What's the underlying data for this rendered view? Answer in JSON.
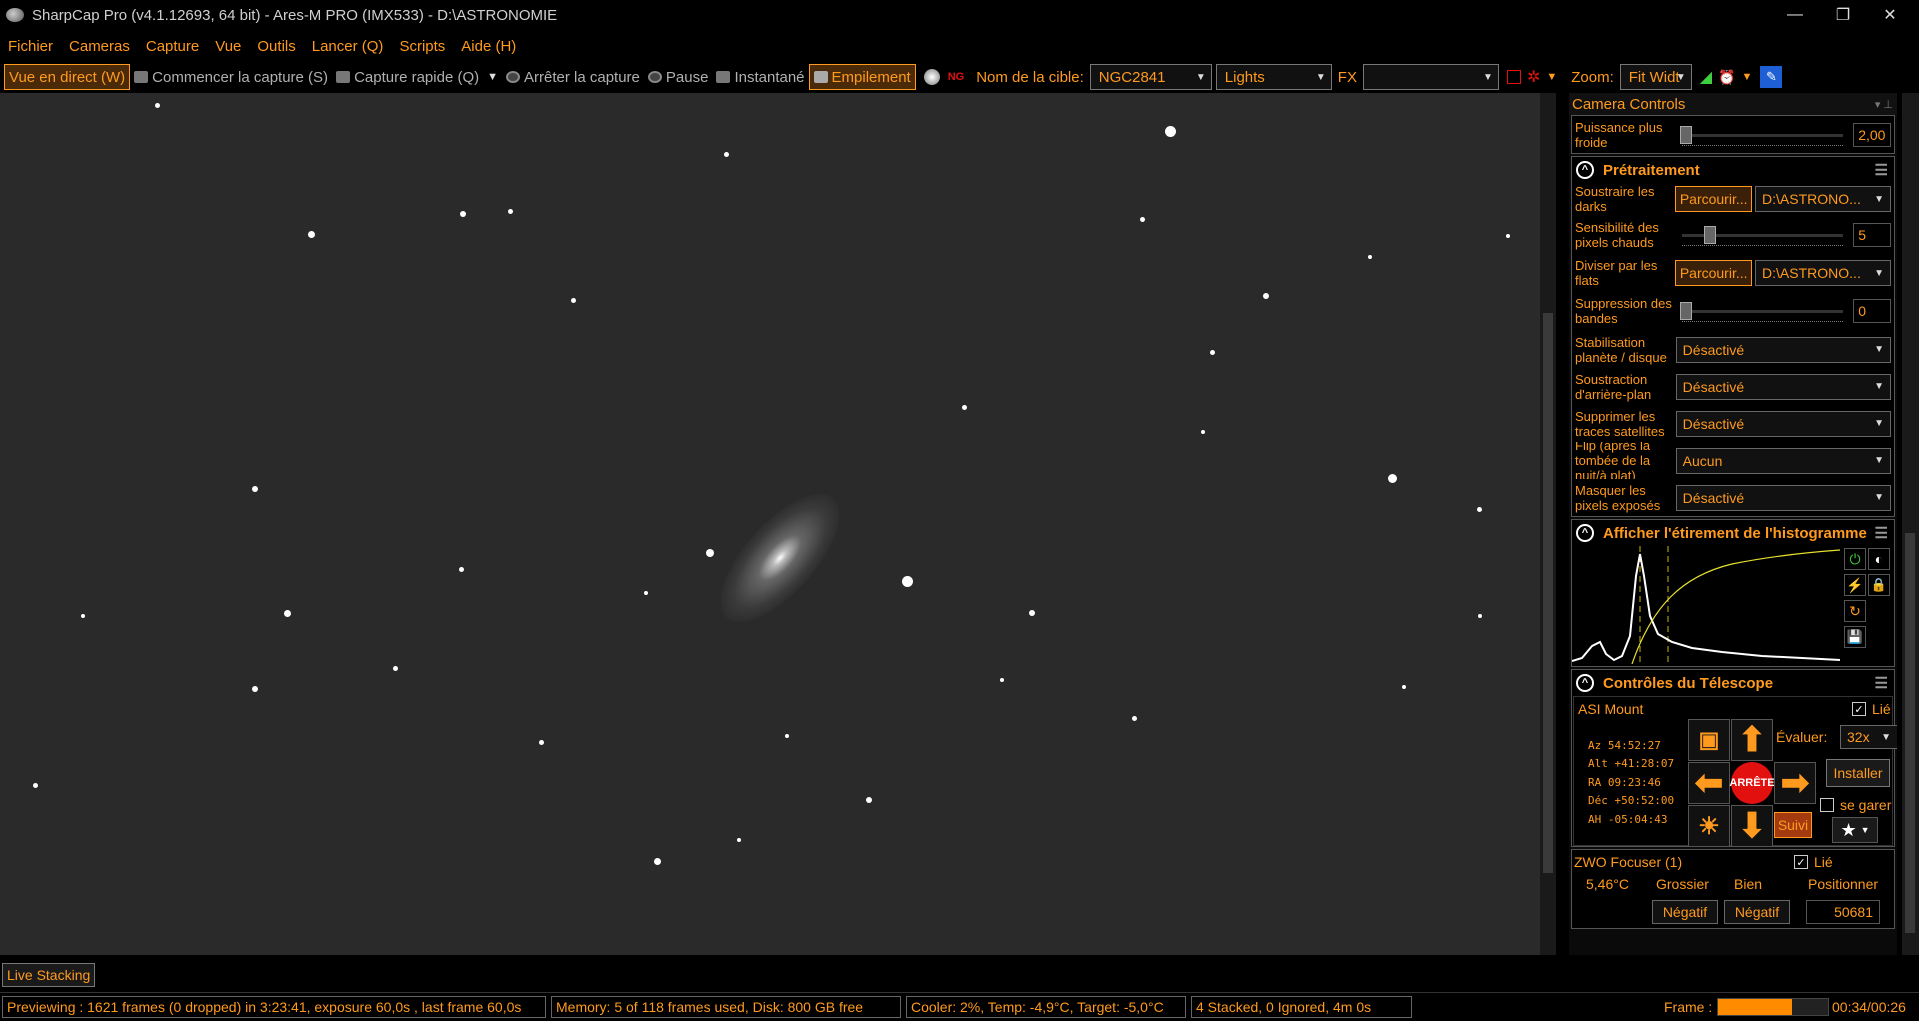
{
  "window": {
    "title": "SharpCap Pro (v4.1.12693, 64 bit) - Ares-M PRO (IMX533) - D:\\ASTRONOMIE",
    "minimize": "—",
    "maximize": "❐",
    "close": "✕"
  },
  "menu": [
    "Fichier",
    "Cameras",
    "Capture",
    "Vue",
    "Outils",
    "Lancer (Q)",
    "Scripts",
    "Aide (H)"
  ],
  "toolbar": {
    "live_view": "Vue en direct (W)",
    "start_capture": "Commencer la capture (S)",
    "quick_capture": "Capture rapide (Q)",
    "stop_capture": "Arrêter la capture",
    "pause": "Pause",
    "snapshot": "Instantané",
    "stacking": "Empilement",
    "target_label": "Nom de la cible:",
    "target_value": "NGC2841",
    "frame_type": "Lights",
    "fx_label": "FX",
    "fx_value": "",
    "zoom_label": "Zoom:",
    "zoom_value": "Fit Widt"
  },
  "panel": {
    "header": "Camera Controls",
    "cooler_power": {
      "label": "Puissance plus froide",
      "value": "2,00"
    },
    "preprocessing": {
      "title": "Prétraitement",
      "darks_label": "Soustraire les darks",
      "darks_browse": "Parcourir...",
      "darks_path": "D:\\ASTRONO...",
      "hot_pixels_label": "Sensibilité des pixels chauds",
      "hot_pixels_value": "5",
      "flats_label": "Diviser par les flats",
      "flats_browse": "Parcourir...",
      "flats_path": "D:\\ASTRONO...",
      "banding_label": "Suppression des bandes",
      "banding_value": "0",
      "stabilization_label": "Stabilisation planète / disque",
      "stabilization_value": "Désactivé",
      "background_label": "Soustraction d'arrière-plan",
      "background_value": "Désactivé",
      "satellite_label": "Supprimer les traces satellites",
      "satellite_value": "Désactivé",
      "flip_label": "Flip (après la tombée de la nuit/à plat)",
      "flip_value": "Aucun",
      "mask_label": "Masquer les pixels exposés",
      "mask_value": "Désactivé"
    },
    "histogram": {
      "title": "Afficher l'étirement de l'histogramme"
    },
    "telescope": {
      "title": "Contrôles du Télescope",
      "mount": "ASI Mount",
      "linked": "Lié",
      "az": "Az      54:52:27",
      "alt": "Alt  +41:28:07",
      "ra": "RA     09:23:46",
      "dec": "Déc  +50:52:00",
      "ha": "AH   -05:04:43",
      "rate_label": "Évaluer:",
      "rate_value": "32x",
      "install": "Installer",
      "park": "se garer",
      "stop": "ARRÊTE",
      "track": "Suivi"
    },
    "focuser": {
      "name": "ZWO Focuser (1)",
      "linked": "Lié",
      "temp": "5,46°C",
      "coarse": "Grossier",
      "fine": "Bien",
      "position_label": "Positionner",
      "neg1": "Négatif",
      "neg2": "Négatif",
      "position": "50681"
    }
  },
  "tabs": {
    "live_stacking": "Live Stacking"
  },
  "status": {
    "preview": "Previewing : 1621 frames (0 dropped) in 3:23:41, exposure 60,0s , last frame 60,0s",
    "memory": "Memory: 5 of 118 frames used, Disk: 800 GB free",
    "cooler": "Cooler: 2%, Temp: -4,9°C, Target: -5,0°C",
    "stack": "4 Stacked, 0 Ignored, 4m 0s",
    "frame_label": "Frame :",
    "frame_progress": 0.67,
    "time": "00:34/00:26"
  },
  "colors": {
    "accent": "#ff9a1f",
    "stop": "#e31010",
    "background": "#000000"
  }
}
